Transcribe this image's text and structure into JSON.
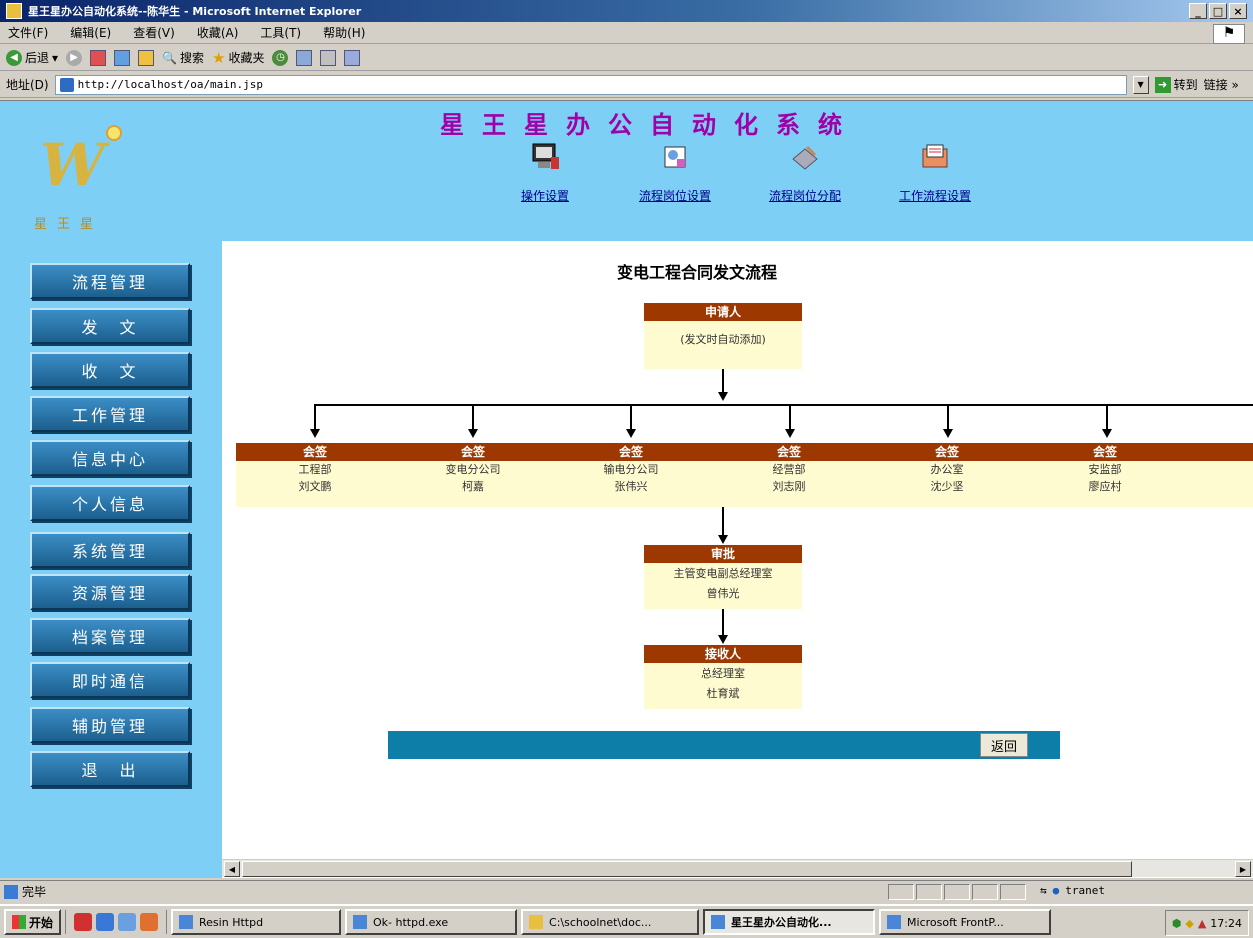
{
  "window": {
    "title": "星王星办公自动化系统--陈华生 - Microsoft Internet Explorer",
    "min": "_",
    "max": "□",
    "close": "×"
  },
  "menu": [
    "文件(F)",
    "编辑(E)",
    "查看(V)",
    "收藏(A)",
    "工具(T)",
    "帮助(H)"
  ],
  "toolbar": {
    "back": "后退",
    "search": "搜索",
    "favorites": "收藏夹"
  },
  "address": {
    "label": "地址(D)",
    "url": "http://localhost/oa/main.jsp",
    "go": "转到",
    "links": "链接 »"
  },
  "header": {
    "system_title": "星王星办公自动化系统",
    "logo_text": "星王星",
    "nav": [
      {
        "label": "操作设置",
        "icon": "computer-icon"
      },
      {
        "label": "流程岗位设置",
        "icon": "document-icon"
      },
      {
        "label": "流程岗位分配",
        "icon": "pen-icon"
      },
      {
        "label": "工作流程设置",
        "icon": "list-icon"
      }
    ]
  },
  "sidebar": {
    "items": [
      "流程管理",
      "发　文",
      "收　文",
      "工作管理",
      "信息中心",
      "个人信息",
      "系统管理",
      "资源管理",
      "档案管理",
      "即时通信",
      "辅助管理",
      "退　出"
    ]
  },
  "flow": {
    "title": "变电工程合同发文流程",
    "applicant": {
      "header": "申请人",
      "body": "(发文时自动添加)"
    },
    "countersign": [
      {
        "header": "会签",
        "dept": "工程部",
        "person": "刘文鹏"
      },
      {
        "header": "会签",
        "dept": "变电分公司",
        "person": "柯嘉"
      },
      {
        "header": "会签",
        "dept": "输电分公司",
        "person": "张伟兴"
      },
      {
        "header": "会签",
        "dept": "经营部",
        "person": "刘志刚"
      },
      {
        "header": "会签",
        "dept": "办公室",
        "person": "沈少坚"
      },
      {
        "header": "会签",
        "dept": "安监部",
        "person": "廖应村"
      }
    ],
    "approval": {
      "header": "审批",
      "dept": "主管变电副总经理室",
      "person": "曾伟光"
    },
    "receiver": {
      "header": "接收人",
      "dept": "总经理室",
      "person": "杜育斌"
    },
    "return_label": "返回"
  },
  "status": {
    "text": "完毕",
    "zone": "tranet"
  },
  "taskbar": {
    "start": "开始",
    "tasks": [
      "Resin Httpd",
      "Ok- httpd.exe",
      "C:\\schoolnet\\doc...",
      "星王星办公自动化...",
      "Microsoft FrontP..."
    ],
    "clock": "17:24"
  }
}
